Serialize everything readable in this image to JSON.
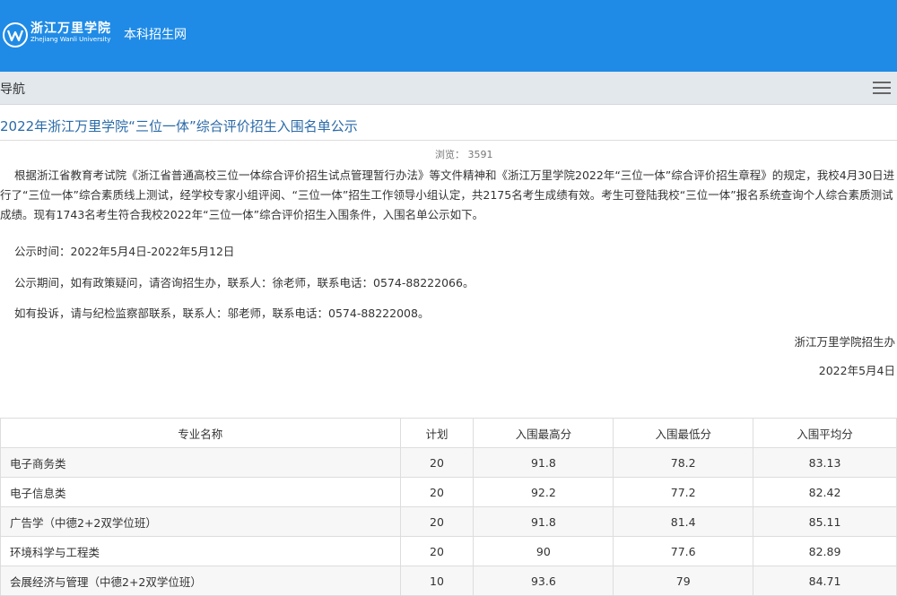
{
  "header": {
    "logo_cn": "浙江万里学院",
    "logo_en": "Zhejiang Wanli University",
    "site_name": "本科招生网"
  },
  "nav": {
    "label": "导航"
  },
  "article": {
    "title": "2022年浙江万里学院“三位一体”综合评价招生入围名单公示",
    "views": "浏览： 3591",
    "paragraph": "根据浙江省教育考试院《浙江省普通高校三位一体综合评价招生试点管理暂行办法》等文件精神和《浙江万里学院2022年“三位一体”综合评价招生章程》的规定，我校4月30日进行了“三位一体”综合素质线上测试，经学校专家小组评阅、“三位一体”招生工作领导小组认定，共2175名考生成绩有效。考生可登陆我校“三位一体”报名系统查询个人综合素质测试成绩。现有1743名考生符合我校2022年“三位一体”综合评价招生入围条件，入围名单公示如下。",
    "announce_time": "公示时间：2022年5月4日-2022年5月12日",
    "policy_contact": "公示期间，如有政策疑问，请咨询招生办，联系人：徐老师，联系电话：0574-88222066。",
    "complaint_contact": "如有投诉，请与纪检监察部联系，联系人：邬老师，联系电话：0574-88222008。",
    "signature": "浙江万里学院招生办",
    "date": "2022年5月4日"
  },
  "table": {
    "headers": [
      "专业名称",
      "计划",
      "入围最高分",
      "入围最低分",
      "入围平均分"
    ],
    "rows": [
      [
        "电子商务类",
        "20",
        "91.8",
        "78.2",
        "83.13"
      ],
      [
        "电子信息类",
        "20",
        "92.2",
        "77.2",
        "82.42"
      ],
      [
        "广告学（中德2+2双学位班）",
        "20",
        "91.8",
        "81.4",
        "85.11"
      ],
      [
        "环境科学与工程类",
        "20",
        "90",
        "77.6",
        "82.89"
      ],
      [
        "会展经济与管理（中德2+2双学位班）",
        "10",
        "93.6",
        "79",
        "84.71"
      ]
    ]
  },
  "colors": {
    "header_bg": "#1f8be6",
    "nav_bg": "#e3e8ed",
    "title": "#2a6aa8"
  },
  "icons": {
    "menu": "hamburger-menu-icon",
    "logo": "university-emblem-icon"
  }
}
